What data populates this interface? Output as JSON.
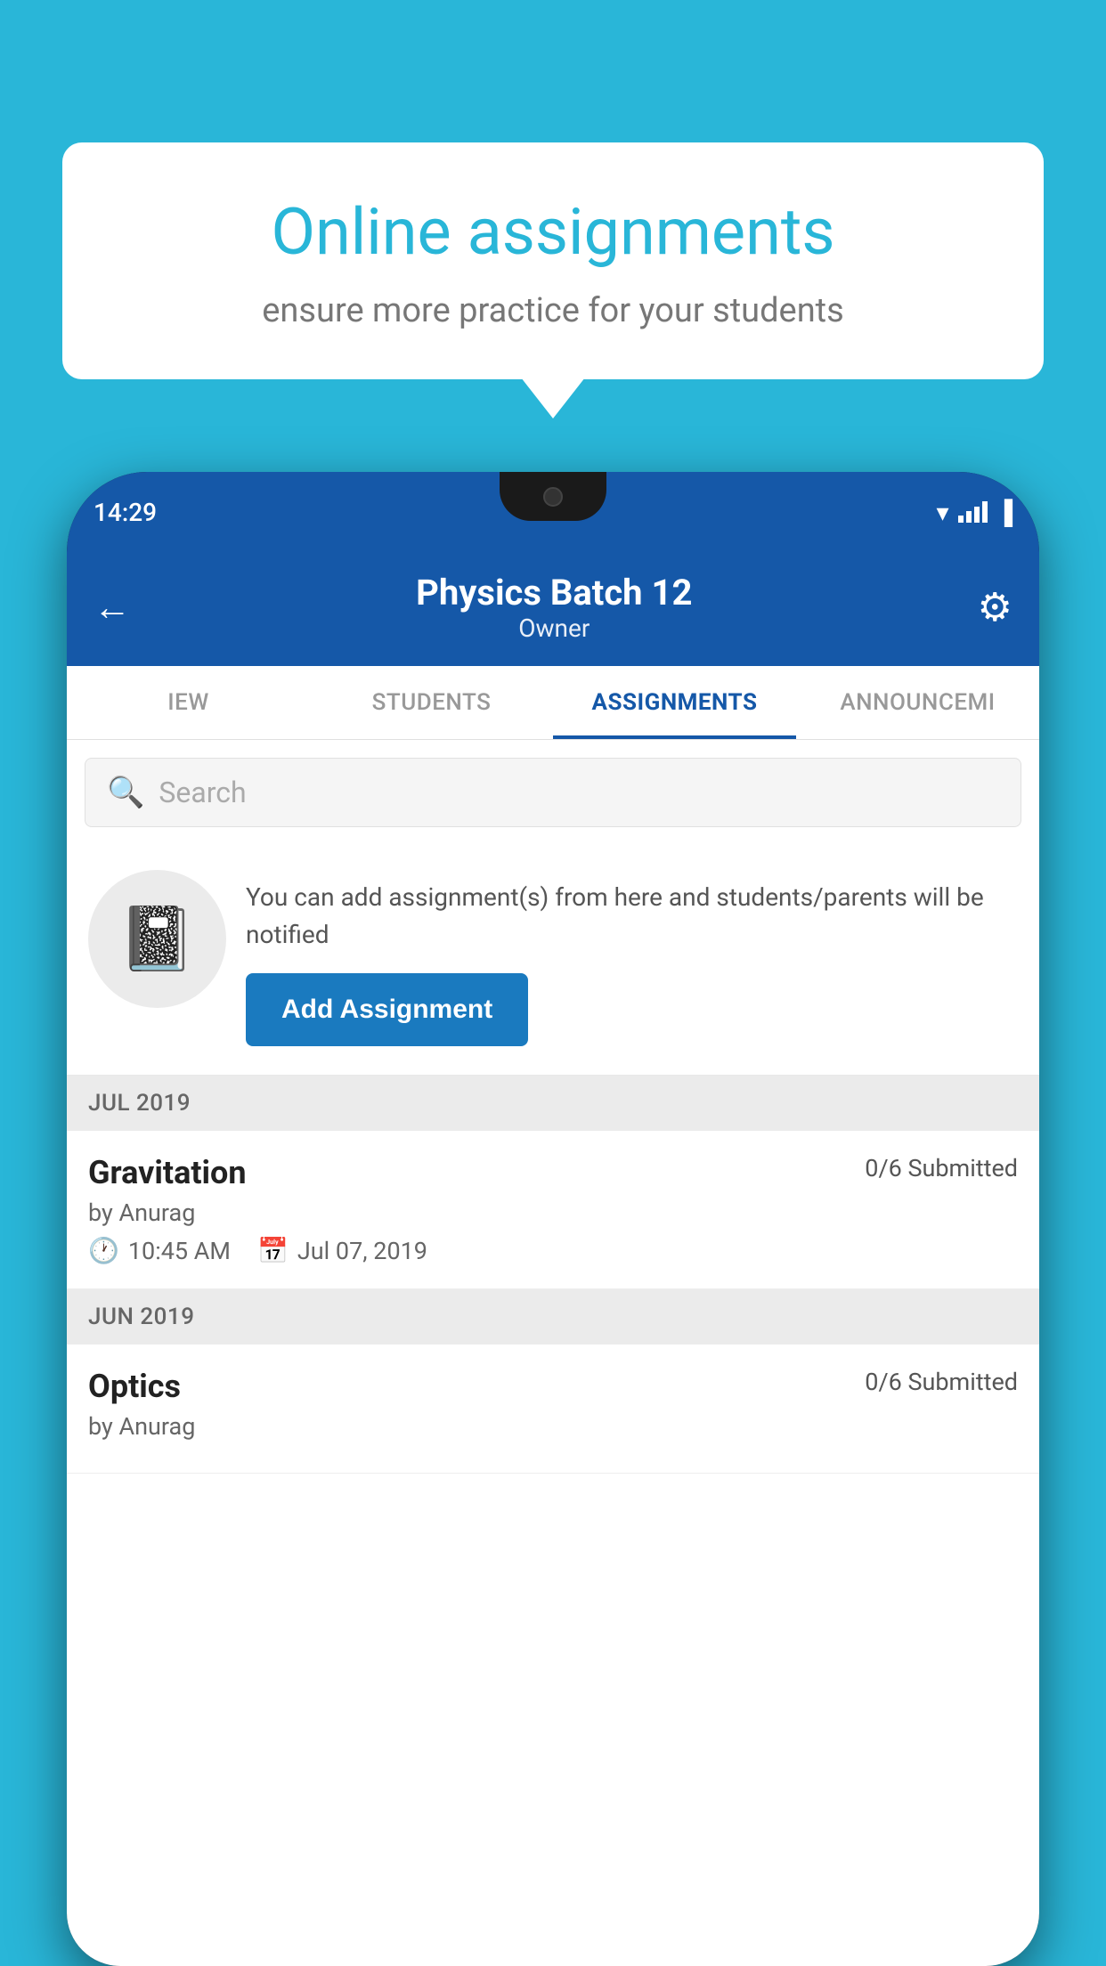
{
  "background_color": "#29B6D8",
  "speech_bubble": {
    "title": "Online assignments",
    "subtitle": "ensure more practice for your students"
  },
  "phone": {
    "status_bar": {
      "time": "14:29"
    },
    "header": {
      "title": "Physics Batch 12",
      "subtitle": "Owner",
      "back_label": "←",
      "settings_label": "⚙"
    },
    "tabs": [
      {
        "label": "IEW",
        "active": false
      },
      {
        "label": "STUDENTS",
        "active": false
      },
      {
        "label": "ASSIGNMENTS",
        "active": true
      },
      {
        "label": "ANNOUNCEMI",
        "active": false
      }
    ],
    "search": {
      "placeholder": "Search"
    },
    "promo": {
      "description": "You can add assignment(s) from here and students/parents will be notified",
      "button_label": "Add Assignment"
    },
    "month_sections": [
      {
        "month_label": "JUL 2019",
        "assignments": [
          {
            "name": "Gravitation",
            "submitted": "0/6 Submitted",
            "author": "by Anurag",
            "time": "10:45 AM",
            "date": "Jul 07, 2019"
          }
        ]
      },
      {
        "month_label": "JUN 2019",
        "assignments": [
          {
            "name": "Optics",
            "submitted": "0/6 Submitted",
            "author": "by Anurag",
            "time": "",
            "date": ""
          }
        ]
      }
    ]
  }
}
